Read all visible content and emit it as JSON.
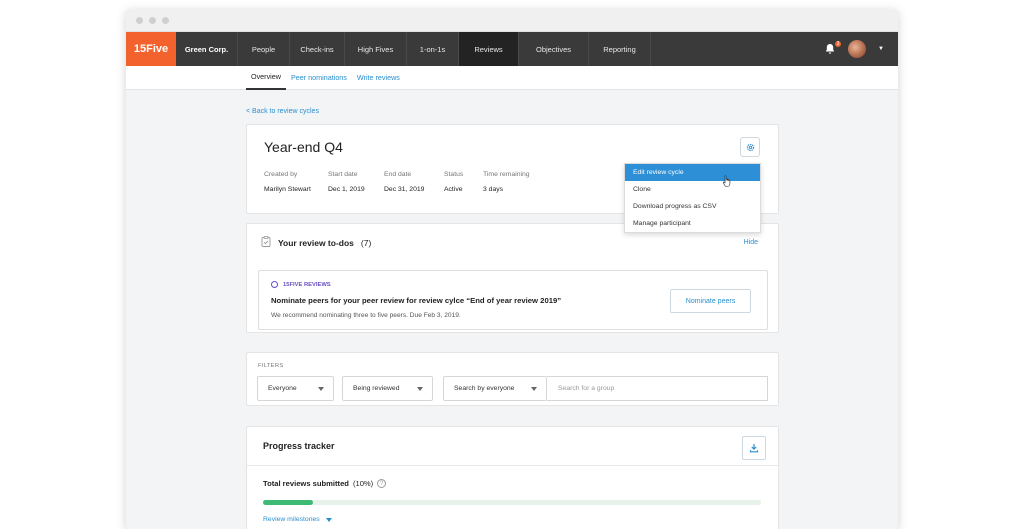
{
  "app": {
    "logo": "15Five",
    "company": "Green Corp.",
    "notification_count": "3"
  },
  "nav": {
    "items": [
      {
        "label": "People",
        "width": 52
      },
      {
        "label": "Check-ins",
        "width": 55
      },
      {
        "label": "High Fives",
        "width": 62
      },
      {
        "label": "1-on-1s",
        "width": 52
      },
      {
        "label": "Reviews",
        "width": 60,
        "active": true
      },
      {
        "label": "Objectives",
        "width": 70
      },
      {
        "label": "Reporting",
        "width": 62
      }
    ]
  },
  "subnav": {
    "overview": "Overview",
    "peer": "Peer nominations",
    "write": "Write reviews"
  },
  "back_link": "< Back to review cycles",
  "cycle": {
    "title": "Year-end Q4",
    "created_by_label": "Created by",
    "created_by": "Marilyn Stewart",
    "start_label": "Start date",
    "start": "Dec 1, 2019",
    "end_label": "End date",
    "end": "Dec 31, 2019",
    "status_label": "Status",
    "status": "Active",
    "remaining_label": "Time remaining",
    "remaining": "3 days"
  },
  "settings_menu": {
    "items": [
      "Edit review cycle",
      "Clone",
      "Download progress as CSV",
      "Manage participant"
    ]
  },
  "todos": {
    "title": "Your review to-dos",
    "count": "(7)",
    "hide": "Hide",
    "item": {
      "tag": "15FIVE REVIEWS",
      "title": "Nominate peers for your peer review for review cylce “End of year review 2019”",
      "subtitle": "We recommend nominating three to five peers. Due Feb 3, 2019.",
      "button": "Nominate peers"
    }
  },
  "filters": {
    "label": "FILTERS",
    "everyone": "Everyone",
    "being_reviewed": "Being reviewed",
    "search_by": "Search by everyone",
    "search_placeholder": "Search for a group"
  },
  "progress": {
    "title": "Progress tracker",
    "total_label": "Total reviews submitted",
    "total_pct": "(10%)",
    "fraction": 0.1,
    "milestones": "Review milestones"
  },
  "colors": {
    "brand": "#f3622d",
    "link": "#2a8fd0",
    "progress": "#3dba74"
  }
}
